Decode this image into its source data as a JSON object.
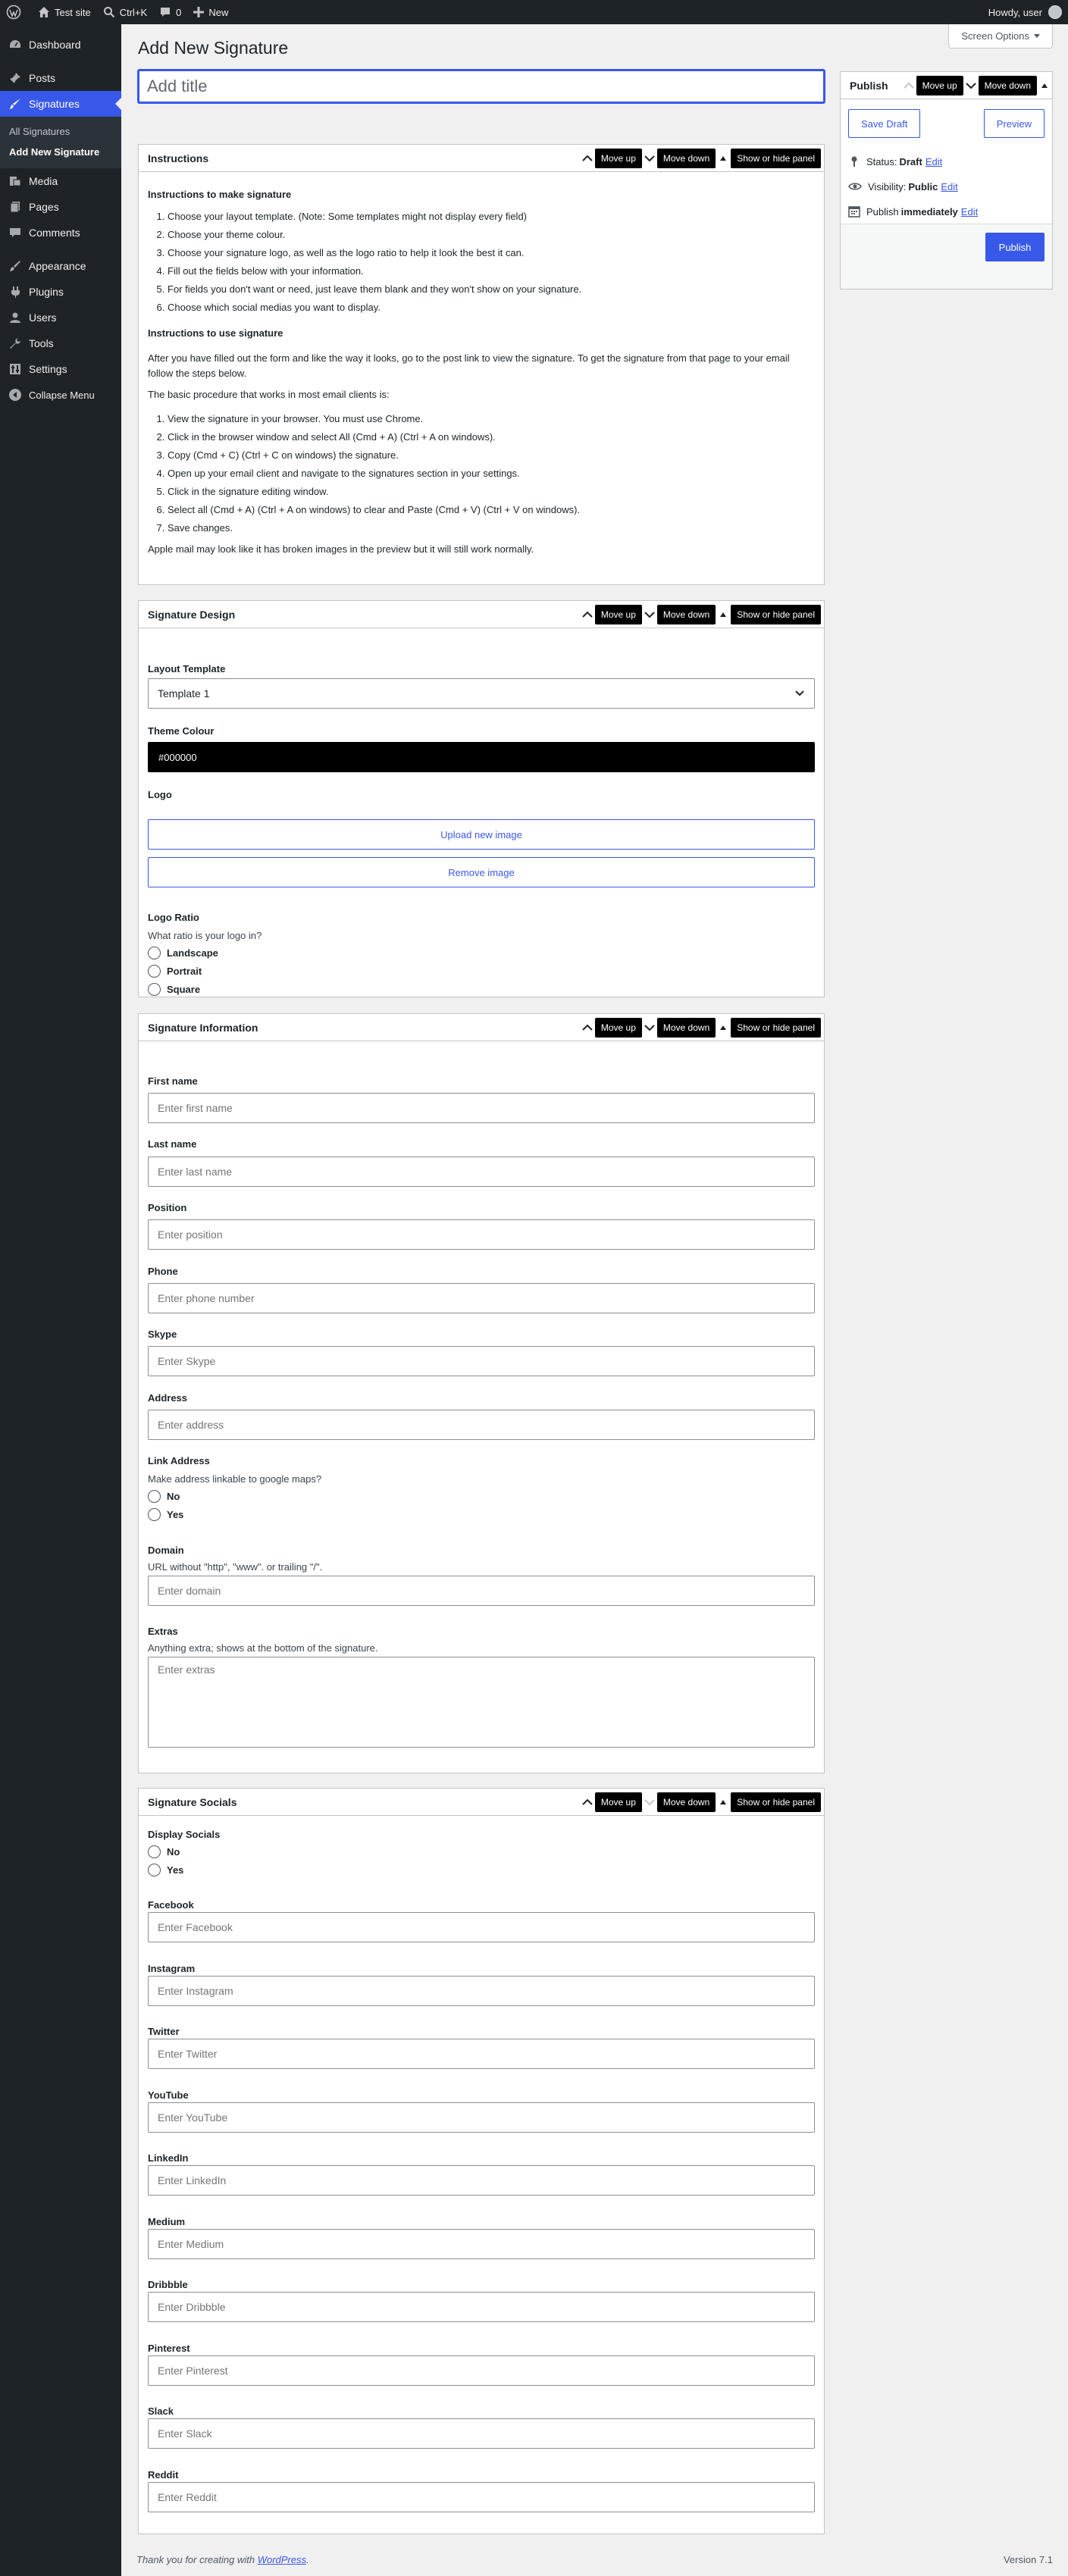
{
  "adminbar": {
    "site_name": "Test site",
    "search_shortcut": "Ctrl+K",
    "comments_count": "0",
    "new_label": "New",
    "howdy": "Howdy, user"
  },
  "sidebar": {
    "items": [
      {
        "label": "Dashboard",
        "icon": "dashboard-icon"
      },
      {
        "label": "Posts",
        "icon": "pin-icon"
      },
      {
        "label": "Signatures",
        "icon": "brush-icon"
      },
      {
        "label": "Media",
        "icon": "media-icon"
      },
      {
        "label": "Pages",
        "icon": "pages-icon"
      },
      {
        "label": "Comments",
        "icon": "comment-icon"
      },
      {
        "label": "Appearance",
        "icon": "appearance-icon"
      },
      {
        "label": "Plugins",
        "icon": "plugin-icon"
      },
      {
        "label": "Users",
        "icon": "users-icon"
      },
      {
        "label": "Tools",
        "icon": "tools-icon"
      },
      {
        "label": "Settings",
        "icon": "settings-icon"
      },
      {
        "label": "Collapse Menu",
        "icon": "collapse-icon"
      }
    ],
    "submenu": [
      "All Signatures",
      "Add New Signature"
    ]
  },
  "screen_options": "Screen Options",
  "page_title": "Add New Signature",
  "title_placeholder": "Add title",
  "controls": {
    "move_up": "Move up",
    "move_down": "Move down",
    "toggle": "Show or hide panel"
  },
  "instructions": {
    "title": "Instructions",
    "make_heading": "Instructions to make signature",
    "make_steps": [
      "Choose your layout template. (Note: Some templates might not display every field)",
      "Choose your theme colour.",
      "Choose your signature logo, as well as the logo ratio to help it look the best it can.",
      "Fill out the fields below with your information.",
      "For fields you don't want or need, just leave them blank and they won't show on your signature.",
      "Choose which social medias you want to display."
    ],
    "use_heading": "Instructions to use signature",
    "use_intro": "After you have filled out the form and like the way it looks, go to the post link to view the signature. To get the signature from that page to your email follow the steps below.",
    "basic_intro": "The basic procedure that works in most email clients is:",
    "use_steps": [
      "View the signature in your browser. You must use Chrome.",
      "Click in the browser window and select All (Cmd + A) (Ctrl + A on windows).",
      "Copy (Cmd + C) (Ctrl + C on windows) the signature.",
      "Open up your email client and navigate to the signatures section in your settings.",
      "Click in the signature editing window.",
      "Select all (Cmd + A) (Ctrl + A on windows) to clear and Paste (Cmd + V) (Ctrl + V on windows).",
      "Save changes."
    ],
    "apple_note": "Apple mail may look like it has broken images in the preview but it will still work normally."
  },
  "design": {
    "title": "Signature Design",
    "layout_label": "Layout Template",
    "layout_value": "Template 1",
    "theme_label": "Theme Colour",
    "theme_value": "#000000",
    "logo_label": "Logo",
    "upload_label": "Upload new image",
    "remove_label": "Remove image",
    "ratio_label": "Logo Ratio",
    "ratio_desc": "What ratio is your logo in?",
    "ratio_options": [
      "Landscape",
      "Portrait",
      "Square"
    ]
  },
  "info": {
    "title": "Signature Information",
    "first_name_label": "First name",
    "first_name_ph": "Enter first name",
    "last_name_label": "Last name",
    "last_name_ph": "Enter last name",
    "position_label": "Position",
    "position_ph": "Enter position",
    "phone_label": "Phone",
    "phone_ph": "Enter phone number",
    "skype_label": "Skype",
    "skype_ph": "Enter Skype",
    "address_label": "Address",
    "address_ph": "Enter address",
    "link_address_label": "Link Address",
    "link_address_desc": "Make address linkable to google maps?",
    "link_options": [
      "No",
      "Yes"
    ],
    "domain_label": "Domain",
    "domain_desc": "URL without \"http\", \"www\". or trailing \"/\".",
    "domain_ph": "Enter domain",
    "extras_label": "Extras",
    "extras_desc": "Anything extra; shows at the bottom of the signature.",
    "extras_ph": "Enter extras"
  },
  "socials": {
    "title": "Signature Socials",
    "display_label": "Display Socials",
    "display_options": [
      "No",
      "Yes"
    ],
    "fields": [
      {
        "label": "Facebook",
        "ph": "Enter Facebook"
      },
      {
        "label": "Instagram",
        "ph": "Enter Instagram"
      },
      {
        "label": "Twitter",
        "ph": "Enter Twitter"
      },
      {
        "label": "YouTube",
        "ph": "Enter YouTube"
      },
      {
        "label": "LinkedIn",
        "ph": "Enter LinkedIn"
      },
      {
        "label": "Medium",
        "ph": "Enter Medium"
      },
      {
        "label": "Dribbble",
        "ph": "Enter Dribbble"
      },
      {
        "label": "Pinterest",
        "ph": "Enter Pinterest"
      },
      {
        "label": "Slack",
        "ph": "Enter Slack"
      },
      {
        "label": "Reddit",
        "ph": "Enter Reddit"
      }
    ]
  },
  "publish": {
    "title": "Publish",
    "save_draft": "Save Draft",
    "preview": "Preview",
    "status_label": "Status:",
    "status_value": "Draft",
    "visibility_label": "Visibility:",
    "visibility_value": "Public",
    "publish_label": "Publish",
    "publish_value": "immediately",
    "edit": "Edit",
    "publish_button": "Publish"
  },
  "footer": {
    "thanks_prefix": "Thank you for creating with",
    "thanks_link": "WordPress",
    "thanks_suffix": ".",
    "version": "Version 7.1"
  },
  "colors": {
    "accent": "#3858e9",
    "sidebar_bg": "#1d2327",
    "page_bg": "#f0f0f1"
  }
}
